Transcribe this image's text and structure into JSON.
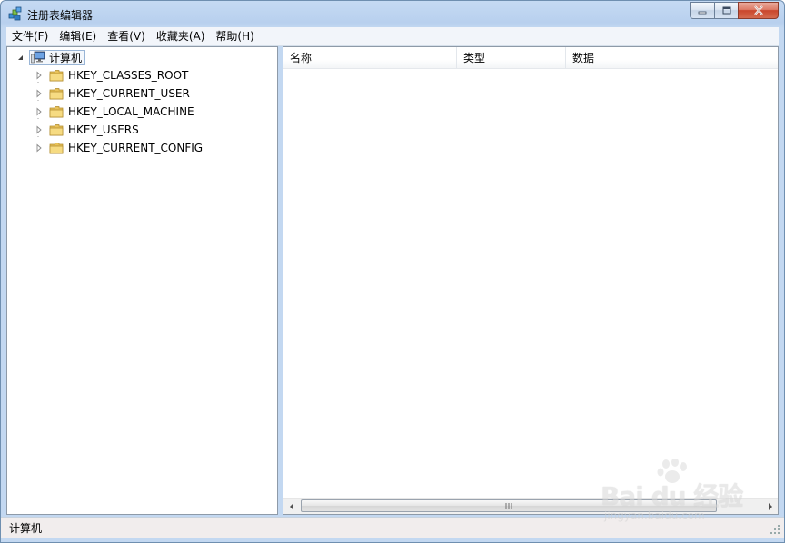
{
  "window": {
    "title": "注册表编辑器",
    "icon": "registry-editor-icon"
  },
  "menu": [
    {
      "label": "文件(F)"
    },
    {
      "label": "编辑(E)"
    },
    {
      "label": "查看(V)"
    },
    {
      "label": "收藏夹(A)"
    },
    {
      "label": "帮助(H)"
    }
  ],
  "tree": {
    "root": {
      "label": "计算机",
      "expanded": true,
      "selected": true
    },
    "children": [
      {
        "label": "HKEY_CLASSES_ROOT"
      },
      {
        "label": "HKEY_CURRENT_USER"
      },
      {
        "label": "HKEY_LOCAL_MACHINE"
      },
      {
        "label": "HKEY_USERS"
      },
      {
        "label": "HKEY_CURRENT_CONFIG"
      }
    ]
  },
  "list": {
    "columns": [
      {
        "label": "名称"
      },
      {
        "label": "类型"
      },
      {
        "label": "数据"
      }
    ],
    "rows": []
  },
  "status": {
    "path": "计算机"
  },
  "watermark": {
    "brand": "Bai du 经验",
    "url": "jingyan.baidu.com"
  },
  "colors": {
    "close_button": "#c9462c",
    "selection_border": "#99b5d6"
  }
}
